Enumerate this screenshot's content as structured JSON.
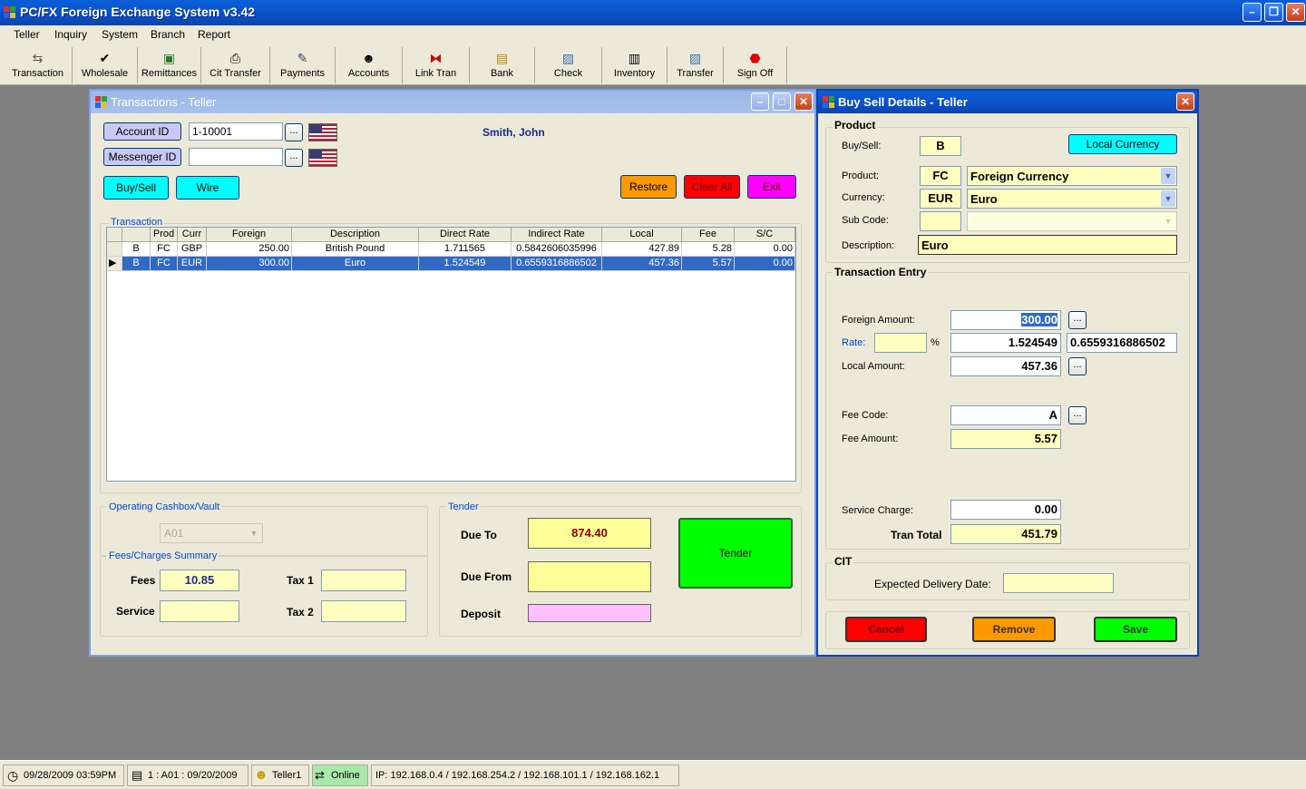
{
  "app": {
    "title": "PC/FX Foreign Exchange System v3.42"
  },
  "menu": [
    "Teller",
    "Inquiry",
    "System",
    "Branch",
    "Report"
  ],
  "toolbar": [
    {
      "label": "Transaction",
      "icon": "transaction-icon"
    },
    {
      "label": "Wholesale",
      "icon": "checkmark-icon"
    },
    {
      "label": "Remittances",
      "icon": "remittances-icon"
    },
    {
      "label": "Cit Transfer",
      "icon": "cit-transfer-icon"
    },
    {
      "label": "Payments",
      "icon": "pen-icon"
    },
    {
      "label": "Accounts",
      "icon": "person-icon"
    },
    {
      "label": "Link Tran",
      "icon": "link-icon"
    },
    {
      "label": "Bank",
      "icon": "bank-icon"
    },
    {
      "label": "Check",
      "icon": "check-icon"
    },
    {
      "label": "Inventory",
      "icon": "inventory-icon"
    },
    {
      "label": "Transfer",
      "icon": "transfer-icon"
    },
    {
      "label": "Sign Off",
      "icon": "stop-icon"
    }
  ],
  "teller": {
    "title": "Transactions - Teller",
    "account_id_label": "Account ID",
    "account_id_value": "1-10001",
    "messenger_id_label": "Messenger ID",
    "messenger_id_value": "",
    "customer_name": "Smith, John",
    "buysell_label": "Buy/Sell",
    "wire_label": "Wire",
    "restore_label": "Restore",
    "clearall_label": "Clear All",
    "exit_label": "Exit",
    "transaction_group": "Transaction",
    "columns": [
      "Prod",
      "Curr",
      "Foreign",
      "Description",
      "Direct Rate",
      "Indirect Rate",
      "Local",
      "Fee",
      "S/C"
    ],
    "rows": [
      {
        "bs": "B",
        "prod": "FC",
        "curr": "GBP",
        "foreign": "250.00",
        "desc": "British Pound",
        "direct": "1.711565",
        "indirect": "0.5842606035996",
        "local": "427.89",
        "fee": "5.28",
        "sc": "0.00"
      },
      {
        "bs": "B",
        "prod": "FC",
        "curr": "EUR",
        "foreign": "300.00",
        "desc": "Euro",
        "direct": "1.524549",
        "indirect": "0.6559316886502",
        "local": "457.36",
        "fee": "5.57",
        "sc": "0.00"
      }
    ],
    "cashbox_group": "Operating Cashbox/Vault",
    "cashbox_value": "A01",
    "fees_group": "Fees/Charges Summary",
    "fees_label": "Fees",
    "fees_value": "10.85",
    "service_label": "Service",
    "service_value": "",
    "tax1_label": "Tax 1",
    "tax2_label": "Tax 2",
    "tender_group": "Tender",
    "due_to_label": "Due To",
    "due_to_value": "874.40",
    "due_from_label": "Due From",
    "deposit_label": "Deposit",
    "tender_label": "Tender"
  },
  "buysell": {
    "title": "Buy Sell Details - Teller",
    "product_group": "Product",
    "buysell_label": "Buy/Sell:",
    "buysell_value": "B",
    "local_currency_label": "Local Currency",
    "product_label": "Product:",
    "product_code": "FC",
    "product_name": "Foreign Currency",
    "currency_label": "Currency:",
    "currency_code": "EUR",
    "currency_name": "Euro",
    "subcode_label": "Sub Code:",
    "description_label": "Description:",
    "description_value": "Euro",
    "entry_group": "Transaction Entry",
    "foreign_amount_label": "Foreign Amount:",
    "foreign_amount_value": "300.00",
    "rate_label": "Rate:",
    "rate_pct": "%",
    "rate_value": "1.524549",
    "indirect_rate_value": "0.6559316886502",
    "local_amount_label": "Local Amount:",
    "local_amount_value": "457.36",
    "fee_code_label": "Fee Code:",
    "fee_code_value": "A",
    "fee_amount_label": "Fee Amount:",
    "fee_amount_value": "5.57",
    "service_charge_label": "Service Charge:",
    "service_charge_value": "0.00",
    "tran_total_label": "Tran Total",
    "tran_total_value": "451.79",
    "cit_group": "CIT",
    "expected_delivery_label": "Expected Delivery Date:",
    "cancel_label": "Cancel",
    "remove_label": "Remove",
    "save_label": "Save"
  },
  "status": {
    "datetime": "09/28/2009 03:59PM",
    "session": "1 : A01 : 09/20/2009",
    "user": "Teller1",
    "online": "Online",
    "ip": "IP: 192.168.0.4 / 192.168.254.2 / 192.168.101.1 / 192.168.162.1"
  },
  "colors": {
    "cyan": "#00ffff",
    "orange": "#ff9900",
    "red": "#ff0000",
    "magenta": "#ff00ff",
    "green": "#00ff00",
    "yellow_field": "#ffff99",
    "pink": "#ffc0ff"
  }
}
